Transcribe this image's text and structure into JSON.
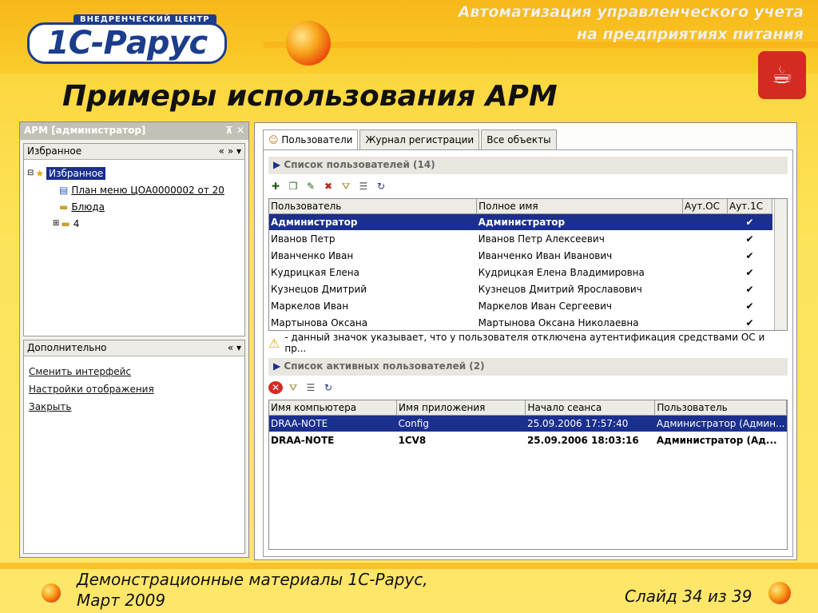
{
  "header": {
    "line1": "Автоматизация управленческого учета",
    "line2": "на предприятиях питания",
    "logo_top": "ВНЕДРЕНЧЕСКИЙ ЦЕНТР",
    "logo_text": "1С-Рарус"
  },
  "slide_title": "Примеры использования АРМ",
  "left_panel": {
    "title": "АРМ [администратор]",
    "pin": "⊼",
    "close": "✕",
    "favorites": {
      "header": "Избранное",
      "nav": "« » ▾",
      "items": [
        "Избранное",
        "План меню ЦОА0000002 от 20",
        "Блюда",
        "4"
      ]
    },
    "extra": {
      "header": "Дополнительно",
      "nav": "« ▾",
      "links": [
        "Сменить интерфейс",
        "Настройки отображения",
        "Закрыть"
      ]
    }
  },
  "tabs": [
    "Пользователи",
    "Журнал регистрации",
    "Все объекты"
  ],
  "users": {
    "group_title": "Список пользователей (14)",
    "columns": [
      "Пользователь",
      "Полное имя",
      "Аут.ОС",
      "Аут.1С"
    ],
    "rows": [
      [
        "Администратор",
        "Администратор",
        "",
        "✔"
      ],
      [
        "Иванов Петр",
        "Иванов Петр Алексеевич",
        "",
        "✔"
      ],
      [
        "Иванченко Иван",
        "Иванченко Иван Иванович",
        "",
        "✔"
      ],
      [
        "Кудрицкая Елена",
        "Кудрицкая Елена Владимировна",
        "",
        "✔"
      ],
      [
        "Кузнецов Дмитрий",
        "Кузнецов Дмитрий Ярославович",
        "",
        "✔"
      ],
      [
        "Маркелов Иван",
        "Маркелов Иван Сергеевич",
        "",
        "✔"
      ],
      [
        "Мартынова Оксана",
        "Мартынова Оксана Николаевна",
        "",
        "✔"
      ]
    ],
    "warning": "- данный значок указывает, что у пользователя отключена аутентификация средствами ОС и пр..."
  },
  "active": {
    "group_title": "Список активных пользователей (2)",
    "columns": [
      "Имя компьютера",
      "Имя приложения",
      "Начало сеанса",
      "Пользователь"
    ],
    "rows": [
      [
        "DRAA-NOTE",
        "Config",
        "25.09.2006 17:57:40",
        "Администратор (Админ..."
      ],
      [
        "DRAA-NOTE",
        "1CV8",
        "25.09.2006 18:03:16",
        "Администратор (Ад..."
      ]
    ]
  },
  "footer": {
    "left_line1": "Демонстрационные материалы 1С-Рарус,",
    "left_line2": "Март 2009",
    "right": "Слайд 34 из 39"
  },
  "colors": {
    "selection": "#1a2f8e",
    "brand": "#1b3d8c",
    "accent": "#e8300c"
  }
}
